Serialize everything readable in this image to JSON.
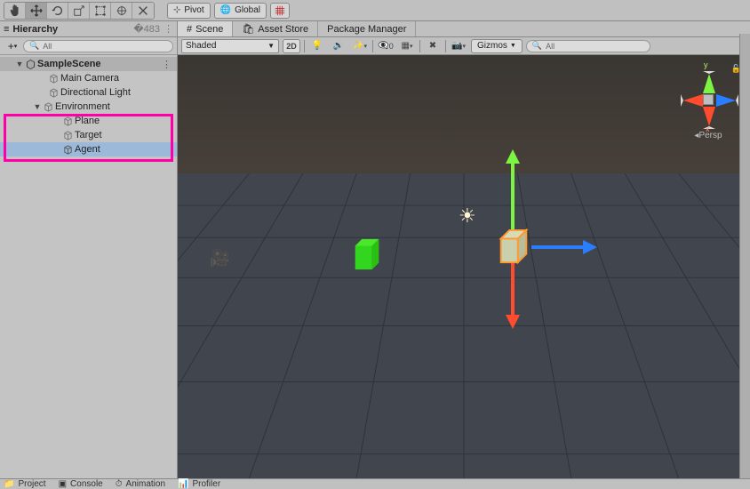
{
  "colors": {
    "highlight": "#ff00a8",
    "green_cube": "#32d61e",
    "accent_blue": "#2b7dff",
    "accent_red": "#ff4b2e",
    "accent_green": "#7ef442"
  },
  "top_toolbar": {
    "tools": [
      "hand",
      "move",
      "rotate",
      "scale",
      "rect",
      "transform",
      "custom"
    ],
    "active_tool": "move",
    "pivot_label": "Pivot",
    "global_label": "Global"
  },
  "hierarchy": {
    "panel_title": "Hierarchy",
    "search_placeholder": "All",
    "scene": "SampleScene",
    "items": [
      {
        "label": "Main Camera",
        "depth": 2
      },
      {
        "label": "Directional Light",
        "depth": 2
      },
      {
        "label": "Environment",
        "depth": 1,
        "expanded": true,
        "highlighted": true
      },
      {
        "label": "Plane",
        "depth": 3,
        "highlighted": true
      },
      {
        "label": "Target",
        "depth": 3,
        "highlighted": true
      },
      {
        "label": "Agent",
        "depth": 3,
        "selected": true,
        "highlighted": true
      }
    ]
  },
  "scene": {
    "tabs": [
      {
        "label": "Scene",
        "active": true
      },
      {
        "label": "Asset Store"
      },
      {
        "label": "Package Manager"
      }
    ],
    "shading_label": "Shaded",
    "mode_2d": "2D",
    "hidden_count": "0",
    "gizmos_label": "Gizmos",
    "search_placeholder": "All",
    "projection_label": "Persp",
    "axes": {
      "x": "x",
      "y": "y",
      "z": "z"
    }
  },
  "bottom": {
    "tabs": [
      "Project",
      "Console",
      "Animation",
      "Profiler"
    ]
  }
}
